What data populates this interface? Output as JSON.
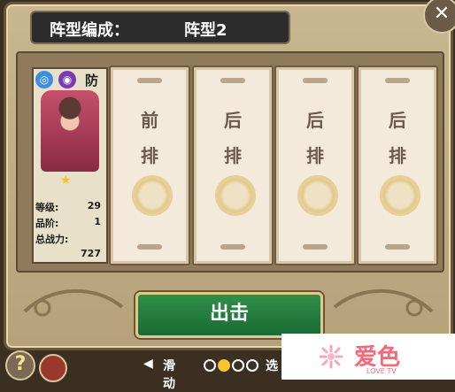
{
  "title": {
    "label": "阵型编成：",
    "value": "阵型2"
  },
  "close_icon": "close-icon",
  "hero": {
    "role": "防",
    "badges": [
      {
        "icon": "water-element-icon",
        "color": "#3a8fe0"
      },
      {
        "icon": "class-emblem-icon",
        "color": "#7a3ab0"
      }
    ],
    "stats": [
      {
        "label": "等级:",
        "value": "29"
      },
      {
        "label": "品阶:",
        "value": "1"
      },
      {
        "label": "总战力:",
        "value": "727"
      }
    ],
    "stars": 1
  },
  "slots": [
    {
      "top": "前",
      "bottom": "排"
    },
    {
      "top": "后",
      "bottom": "排"
    },
    {
      "top": "后",
      "bottom": "排"
    },
    {
      "top": "后",
      "bottom": "排"
    }
  ],
  "go_button": "出击",
  "nav": {
    "left_label": "滑动",
    "pages": 4,
    "active_page": 2,
    "right_label": "选"
  },
  "watermark": {
    "name": "爱色",
    "sub": "LOVE TV"
  }
}
